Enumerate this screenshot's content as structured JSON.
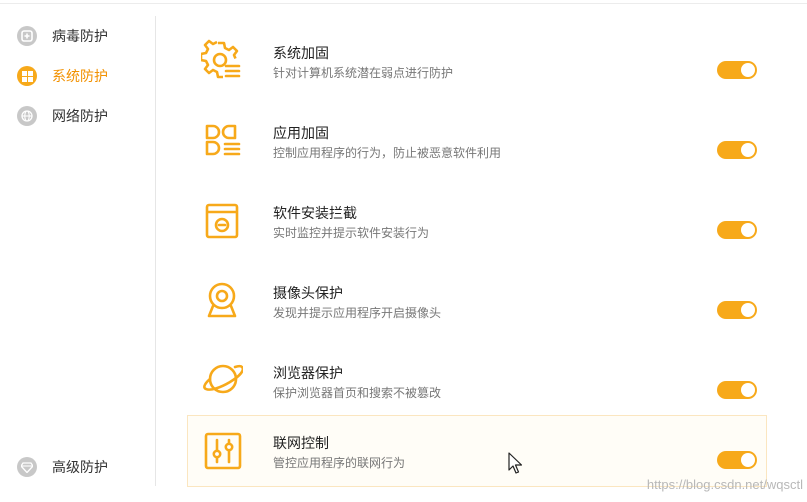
{
  "sidebar": {
    "items": [
      {
        "label": "病毒防护",
        "icon": "plus-circle-icon",
        "active": false
      },
      {
        "label": "系统防护",
        "icon": "windows-icon",
        "active": true
      },
      {
        "label": "网络防护",
        "icon": "globe-icon",
        "active": false
      }
    ],
    "bottom_item": {
      "label": "高级防护",
      "icon": "diamond-icon",
      "active": false
    }
  },
  "protections": [
    {
      "title": "系统加固",
      "desc": "针对计算机系统潜在弱点进行防护",
      "icon": "gear-list-icon",
      "enabled": true
    },
    {
      "title": "应用加固",
      "desc": "控制应用程序的行为，防止被恶意软件利用",
      "icon": "app-grid-icon",
      "enabled": true
    },
    {
      "title": "软件安装拦截",
      "desc": "实时监控并提示软件安装行为",
      "icon": "install-block-icon",
      "enabled": true
    },
    {
      "title": "摄像头保护",
      "desc": "发现并提示应用程序开启摄像头",
      "icon": "webcam-icon",
      "enabled": true
    },
    {
      "title": "浏览器保护",
      "desc": "保护浏览器首页和搜索不被篡改",
      "icon": "planet-icon",
      "enabled": true
    },
    {
      "title": "联网控制",
      "desc": "管控应用程序的联网行为",
      "icon": "sliders-icon",
      "enabled": true
    }
  ],
  "watermark": "https://blog.csdn.net/wqsctl",
  "colors": {
    "accent": "#f7a91a",
    "accent_text": "#f29100",
    "inactive_icon": "#c8c8c8"
  }
}
